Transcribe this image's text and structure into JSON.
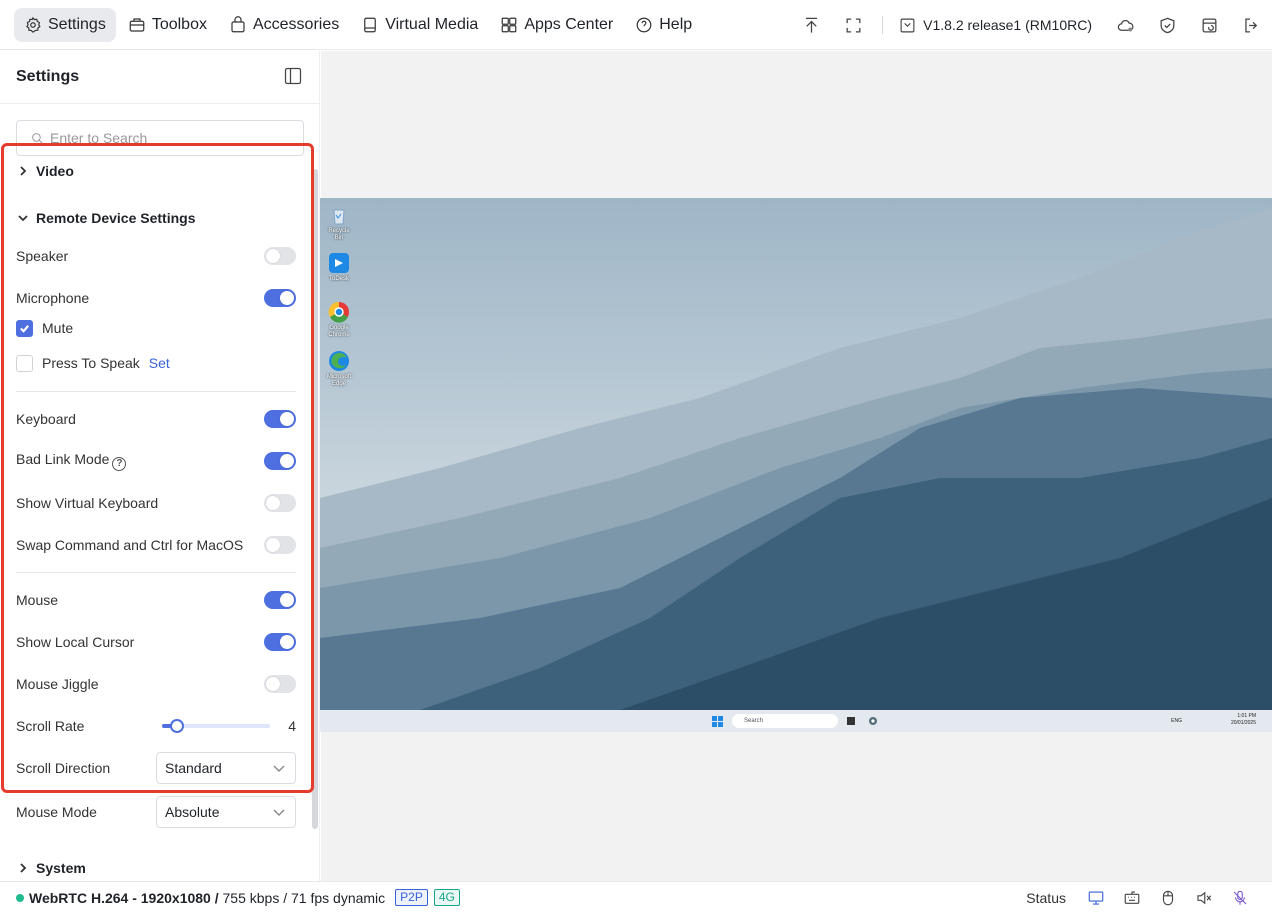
{
  "topbar": {
    "nav": [
      {
        "label": "Settings",
        "icon": "gear-icon",
        "active": true
      },
      {
        "label": "Toolbox",
        "icon": "toolbox-icon"
      },
      {
        "label": "Accessories",
        "icon": "bag-icon"
      },
      {
        "label": "Virtual Media",
        "icon": "disk-icon"
      },
      {
        "label": "Apps Center",
        "icon": "apps-icon"
      },
      {
        "label": "Help",
        "icon": "question-icon"
      }
    ],
    "version": "V1.8.2 release1 (RM10RC)"
  },
  "sidebar": {
    "title": "Settings",
    "search_placeholder": "Enter to Search",
    "sections": {
      "video": "Video",
      "remote": "Remote Device Settings",
      "system": "System"
    },
    "rows": {
      "speaker": {
        "label": "Speaker",
        "on": false
      },
      "microphone": {
        "label": "Microphone",
        "on": true
      },
      "mute": {
        "label": "Mute",
        "checked": true
      },
      "press_to_speak": {
        "label": "Press To Speak",
        "checked": false,
        "link": "Set"
      },
      "keyboard": {
        "label": "Keyboard",
        "on": true
      },
      "bad_link_mode": {
        "label": "Bad Link Mode",
        "on": true
      },
      "show_virtual_keyboard": {
        "label": "Show Virtual Keyboard",
        "on": false
      },
      "swap_cmd_ctrl": {
        "label": "Swap Command and Ctrl for MacOS",
        "on": false
      },
      "mouse": {
        "label": "Mouse",
        "on": true
      },
      "show_local_cursor": {
        "label": "Show Local Cursor",
        "on": true
      },
      "mouse_jiggle": {
        "label": "Mouse Jiggle",
        "on": false
      },
      "scroll_rate": {
        "label": "Scroll Rate",
        "value": "4",
        "fraction": 0.12
      },
      "scroll_direction": {
        "label": "Scroll Direction",
        "value": "Standard"
      },
      "mouse_mode": {
        "label": "Mouse Mode",
        "value": "Absolute"
      }
    }
  },
  "remote_screen": {
    "desktop_icons": [
      "Recycle Bin",
      "ToDesk",
      "Google Chrome",
      "Microsoft Edge"
    ],
    "taskbar_search": "Search",
    "language": "ENG",
    "clock_time": "1:01 PM",
    "clock_date": "20/01/2025"
  },
  "statusbar": {
    "stream_bold": "WebRTC H.264 - 1920x1080 /",
    "stream_rest": " 755 kbps / 71 fps dynamic",
    "badge_p2p": "P2P",
    "badge_4g": "4G",
    "status_label": "Status"
  },
  "colors": {
    "accent": "#4d6fe0",
    "highlight": "#e53b2c",
    "online": "#1fba8e"
  }
}
